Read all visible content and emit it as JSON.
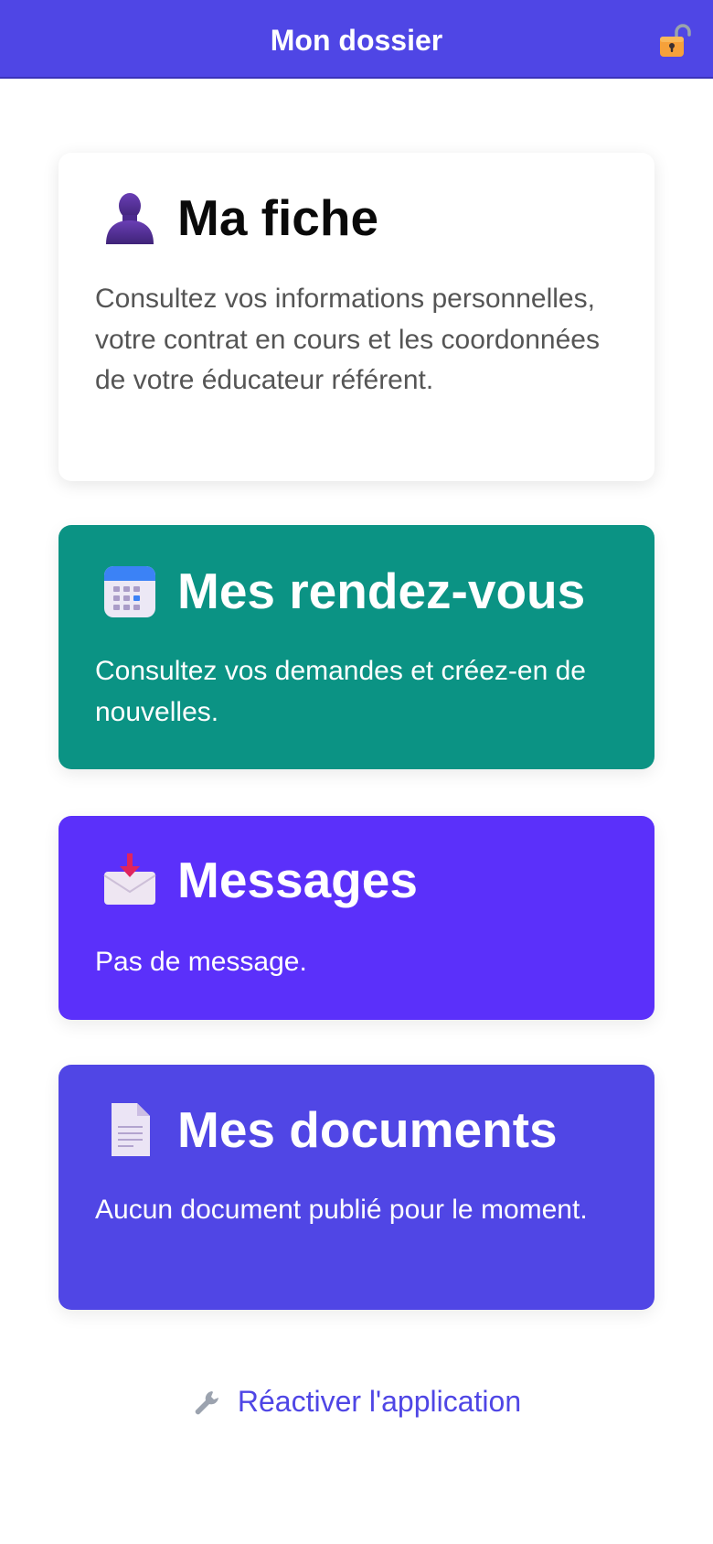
{
  "header": {
    "title": "Mon dossier",
    "lock_icon": "open-lock-icon"
  },
  "cards": [
    {
      "title": "Ma fiche",
      "description": "Consultez vos informations personnelles, votre contrat en cours et les coordonnées de votre éducateur référent.",
      "icon": "person-silhouette-icon",
      "background": "#ffffff"
    },
    {
      "title": "Mes rendez-vous",
      "description": "Consultez vos demandes et créez-en de nouvelles.",
      "icon": "calendar-icon",
      "background": "#0b9384"
    },
    {
      "title": "Messages",
      "description": "Pas de message.",
      "icon": "inbox-tray-icon",
      "background": "#5b30fa"
    },
    {
      "title": "Mes documents",
      "description": "Aucun document publié pour le moment.",
      "icon": "document-icon",
      "background": "#5046e5"
    }
  ],
  "footer": {
    "reactivate_label": "Réactiver l'application",
    "icon": "wrench-icon"
  },
  "colors": {
    "accent": "#4f46e5",
    "teal": "#0b9384",
    "violet": "#5b30fa",
    "indigo": "#5046e5"
  }
}
